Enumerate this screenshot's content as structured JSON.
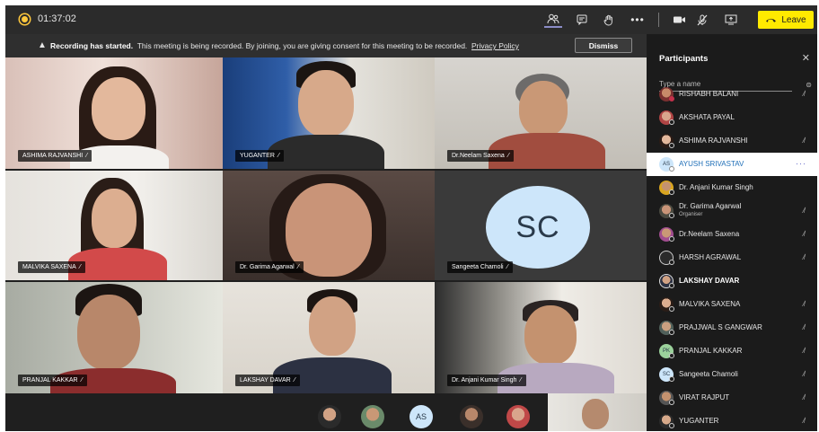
{
  "meeting": {
    "timer": "01:37:02",
    "leave_label": "Leave",
    "banner": {
      "title": "Recording has started.",
      "message": "This meeting is being recorded. By joining, you are giving consent for this meeting to be recorded.",
      "link": "Privacy Policy",
      "dismiss": "Dismiss"
    }
  },
  "tiles": [
    {
      "name": "ASHIMA RAJVANSHI"
    },
    {
      "name": "YUGANTER"
    },
    {
      "name": "Dr.Neelam Saxena"
    },
    {
      "name": "MALVIKA SAXENA"
    },
    {
      "name": "Dr. Garima Agarwal"
    },
    {
      "name": "Sangeeta Chamoli",
      "initials": "SC"
    },
    {
      "name": "PRANJAL KAKKAR"
    },
    {
      "name": "LAKSHAY DAVAR"
    },
    {
      "name": "Dr. Anjani Kumar Singh"
    }
  ],
  "strip": {
    "initials": "AS"
  },
  "participants": {
    "title": "Participants",
    "search_placeholder": "Type a name",
    "items": [
      {
        "name": "RISHABH BALANI"
      },
      {
        "name": "AKSHATA PAYAL"
      },
      {
        "name": "ASHIMA RAJVANSHI"
      },
      {
        "name": "AYUSH SRIVASTAV",
        "initials": "AS",
        "more": "···"
      },
      {
        "name": "Dr. Anjani Kumar Singh"
      },
      {
        "name": "Dr. Garima Agarwal",
        "role": "Organiser"
      },
      {
        "name": "Dr.Neelam Saxena"
      },
      {
        "name": "HARSH AGRAWAL"
      },
      {
        "name": "LAKSHAY DAVAR"
      },
      {
        "name": "MALVIKA SAXENA"
      },
      {
        "name": "PRAJJWAL S GANGWAR"
      },
      {
        "name": "PRANJAL KAKKAR",
        "initials": "PK"
      },
      {
        "name": "Sangeeta Chamoli",
        "initials": "SC"
      },
      {
        "name": "VIRAT RAJPUT"
      },
      {
        "name": "YUGANTER"
      }
    ]
  }
}
